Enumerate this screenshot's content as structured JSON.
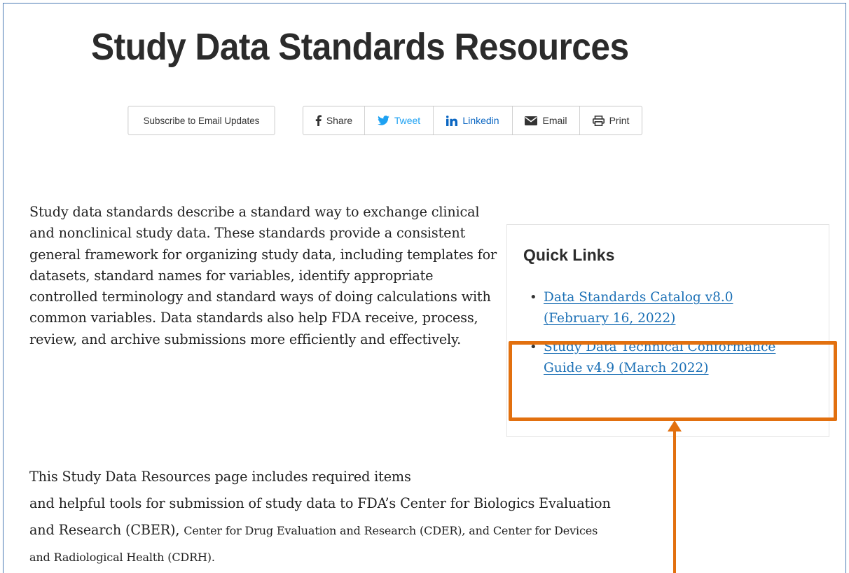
{
  "page": {
    "title": "Study Data Standards Resources"
  },
  "actions": {
    "subscribe_label": "Subscribe to Email Updates",
    "share_buttons": [
      {
        "label": "Share",
        "icon": "facebook-icon"
      },
      {
        "label": "Tweet",
        "icon": "twitter-icon"
      },
      {
        "label": "Linkedin",
        "icon": "linkedin-icon"
      },
      {
        "label": "Email",
        "icon": "envelope-icon"
      },
      {
        "label": "Print",
        "icon": "printer-icon"
      }
    ]
  },
  "intro": {
    "paragraph": "Study data standards describe a standard way to exchange clinical and nonclinical study data. These standards provide a consistent general framework for organizing study data, including templates for datasets, standard names for variables, identify appropriate controlled terminology and standard ways of doing calculations with common variables. Data standards also help FDA receive, process, review, and archive submissions more efficiently and effectively."
  },
  "quick_links": {
    "title": "Quick Links",
    "items": [
      {
        "label": "Data Standards Catalog v8.0 (February 16, 2022)"
      },
      {
        "label": "Study Data Technical Conformance Guide v4.9 (March 2022)"
      }
    ]
  },
  "resources": {
    "line1": "This Study Data Resources page includes required items",
    "line2": "and helpful tools for submission of study data to FDA’s Center for Biologics Evaluation",
    "line3a": "and Research (CBER), ",
    "line3b": "Center for Drug Evaluation and Research (CDER), and Center for Devices",
    "line4": "and Radiological Health (CDRH)."
  },
  "colors": {
    "link": "#1a6fb5",
    "highlight": "#e2700f",
    "frame": "#4a7ab3",
    "tweet": "#1da1f2",
    "linkedin": "#0a66c2"
  }
}
